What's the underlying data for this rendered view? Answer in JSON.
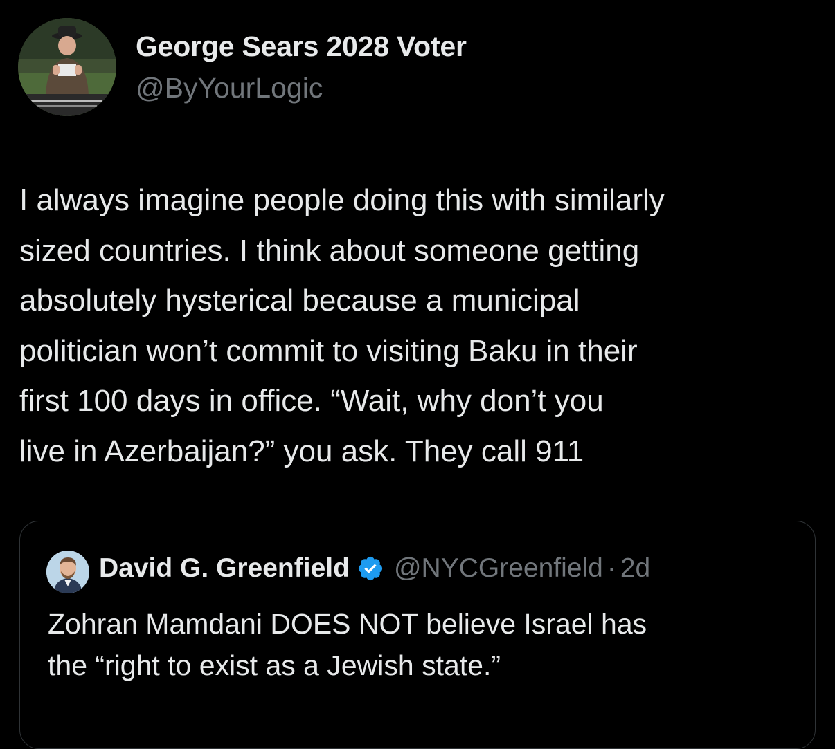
{
  "tweet": {
    "author": {
      "name": "George Sears 2028 Voter",
      "handle": "@ByYourLogic",
      "avatar_icon": "profile-avatar"
    },
    "text_lines": [
      "I always imagine people doing this with similarly",
      "sized countries. I think about someone getting",
      "absolutely hysterical because a municipal",
      "politician won’t commit to visiting Baku in their",
      "first 100 days in office. “Wait, why don’t you",
      "live in Azerbaijan?” you ask. They call 911"
    ]
  },
  "quoted_tweet": {
    "author": {
      "name": "David G. Greenfield",
      "handle": "@NYCGreenfield",
      "separator": "·",
      "time": "2d",
      "verified": true,
      "verified_icon": "verified-badge-icon"
    },
    "text_lines": [
      "Zohran Mamdani DOES NOT believe Israel has",
      "the “right to exist as a Jewish state.”"
    ]
  },
  "colors": {
    "background": "#000000",
    "primary_text": "#e7e9ea",
    "secondary_text": "#71767b",
    "border": "#2f3336",
    "verified_blue": "#1d9bf0"
  }
}
